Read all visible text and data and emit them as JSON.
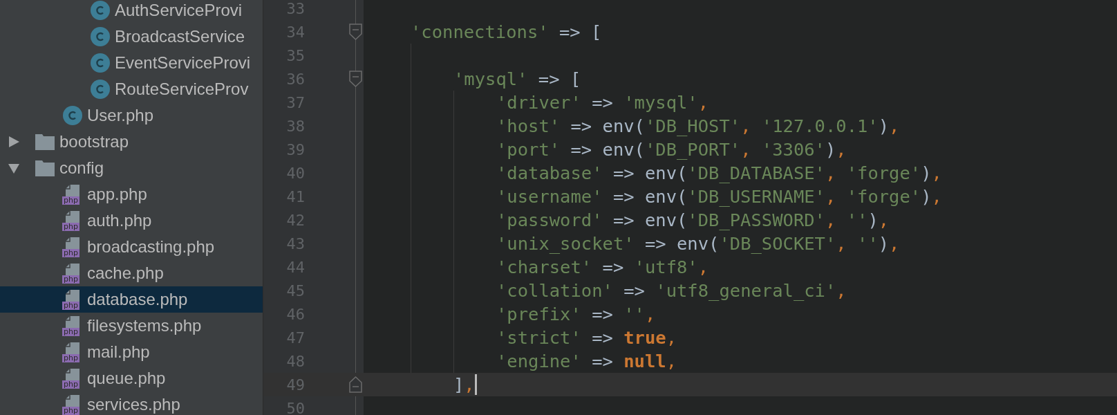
{
  "project_tree": [
    {
      "children": [
        {
          "children": [
            {
              "label": "AuthServiceProvi",
              "kind": "class",
              "selected": false
            },
            {
              "label": "BroadcastService",
              "kind": "class",
              "selected": false
            },
            {
              "label": "EventServiceProvi",
              "kind": "class",
              "selected": false
            },
            {
              "label": "RouteServiceProv",
              "kind": "class",
              "selected": false
            }
          ]
        },
        {
          "label": "User.php",
          "kind": "class",
          "selected": false
        }
      ]
    },
    {
      "label": "bootstrap",
      "kind": "folder",
      "expanded": false,
      "selected": false
    },
    {
      "label": "config",
      "kind": "folder",
      "expanded": true,
      "selected": false,
      "children": [
        {
          "label": "app.php",
          "kind": "php",
          "badge": "php",
          "selected": false
        },
        {
          "label": "auth.php",
          "kind": "php",
          "badge": "php",
          "selected": false
        },
        {
          "label": "broadcasting.php",
          "kind": "php",
          "badge": "php",
          "selected": false
        },
        {
          "label": "cache.php",
          "kind": "php",
          "badge": "php",
          "selected": false
        },
        {
          "label": "database.php",
          "kind": "php",
          "badge": "php",
          "selected": true
        },
        {
          "label": "filesystems.php",
          "kind": "php",
          "badge": "php",
          "selected": false
        },
        {
          "label": "mail.php",
          "kind": "php",
          "badge": "php",
          "selected": false
        },
        {
          "label": "queue.php",
          "kind": "php",
          "badge": "php",
          "selected": false
        },
        {
          "label": "services.php",
          "kind": "php",
          "badge": "php",
          "selected": false
        }
      ]
    }
  ],
  "editor": {
    "lines": [
      {
        "number": "33",
        "current": false
      },
      {
        "number": "34",
        "current": false,
        "fold_start": true,
        "tokens": [
          {
            "kind": "str",
            "text": "'connections'"
          },
          {
            "kind": "plain",
            "text": " => ["
          }
        ],
        "children": [
          {
            "number": "35",
            "current": false
          },
          {
            "number": "36",
            "current": false,
            "fold_start": true,
            "tokens": [
              {
                "kind": "str",
                "text": "'mysql'"
              },
              {
                "kind": "plain",
                "text": " => ["
              }
            ],
            "children": [
              {
                "number": "37",
                "current": false,
                "tokens": [
                  {
                    "kind": "str",
                    "text": "'driver'"
                  },
                  {
                    "kind": "plain",
                    "text": " => "
                  },
                  {
                    "kind": "str",
                    "text": "'mysql'"
                  },
                  {
                    "kind": "comma",
                    "text": ","
                  }
                ]
              },
              {
                "number": "38",
                "current": false,
                "tokens": [
                  {
                    "kind": "str",
                    "text": "'host'"
                  },
                  {
                    "kind": "plain",
                    "text": " => env("
                  },
                  {
                    "kind": "str",
                    "text": "'DB_HOST'"
                  },
                  {
                    "kind": "comma",
                    "text": ", "
                  },
                  {
                    "kind": "str",
                    "text": "'127.0.0.1'"
                  },
                  {
                    "kind": "plain",
                    "text": ")"
                  },
                  {
                    "kind": "comma",
                    "text": ","
                  }
                ]
              },
              {
                "number": "39",
                "current": false,
                "tokens": [
                  {
                    "kind": "str",
                    "text": "'port'"
                  },
                  {
                    "kind": "plain",
                    "text": " => env("
                  },
                  {
                    "kind": "str",
                    "text": "'DB_PORT'"
                  },
                  {
                    "kind": "comma",
                    "text": ", "
                  },
                  {
                    "kind": "str",
                    "text": "'3306'"
                  },
                  {
                    "kind": "plain",
                    "text": ")"
                  },
                  {
                    "kind": "comma",
                    "text": ","
                  }
                ]
              },
              {
                "number": "40",
                "current": false,
                "tokens": [
                  {
                    "kind": "str",
                    "text": "'database'"
                  },
                  {
                    "kind": "plain",
                    "text": " => env("
                  },
                  {
                    "kind": "str",
                    "text": "'DB_DATABASE'"
                  },
                  {
                    "kind": "comma",
                    "text": ", "
                  },
                  {
                    "kind": "str",
                    "text": "'forge'"
                  },
                  {
                    "kind": "plain",
                    "text": ")"
                  },
                  {
                    "kind": "comma",
                    "text": ","
                  }
                ]
              },
              {
                "number": "41",
                "current": false,
                "tokens": [
                  {
                    "kind": "str",
                    "text": "'username'"
                  },
                  {
                    "kind": "plain",
                    "text": " => env("
                  },
                  {
                    "kind": "str",
                    "text": "'DB_USERNAME'"
                  },
                  {
                    "kind": "comma",
                    "text": ", "
                  },
                  {
                    "kind": "str",
                    "text": "'forge'"
                  },
                  {
                    "kind": "plain",
                    "text": ")"
                  },
                  {
                    "kind": "comma",
                    "text": ","
                  }
                ]
              },
              {
                "number": "42",
                "current": false,
                "tokens": [
                  {
                    "kind": "str",
                    "text": "'password'"
                  },
                  {
                    "kind": "plain",
                    "text": " => env("
                  },
                  {
                    "kind": "str",
                    "text": "'DB_PASSWORD'"
                  },
                  {
                    "kind": "comma",
                    "text": ", "
                  },
                  {
                    "kind": "str",
                    "text": "''"
                  },
                  {
                    "kind": "plain",
                    "text": ")"
                  },
                  {
                    "kind": "comma",
                    "text": ","
                  }
                ]
              },
              {
                "number": "43",
                "current": false,
                "tokens": [
                  {
                    "kind": "str",
                    "text": "'unix_socket'"
                  },
                  {
                    "kind": "plain",
                    "text": " => env("
                  },
                  {
                    "kind": "str",
                    "text": "'DB_SOCKET'"
                  },
                  {
                    "kind": "comma",
                    "text": ", "
                  },
                  {
                    "kind": "str",
                    "text": "''"
                  },
                  {
                    "kind": "plain",
                    "text": ")"
                  },
                  {
                    "kind": "comma",
                    "text": ","
                  }
                ]
              },
              {
                "number": "44",
                "current": false,
                "tokens": [
                  {
                    "kind": "str",
                    "text": "'charset'"
                  },
                  {
                    "kind": "plain",
                    "text": " => "
                  },
                  {
                    "kind": "str",
                    "text": "'utf8'"
                  },
                  {
                    "kind": "comma",
                    "text": ","
                  }
                ]
              },
              {
                "number": "45",
                "current": false,
                "tokens": [
                  {
                    "kind": "str",
                    "text": "'collation'"
                  },
                  {
                    "kind": "plain",
                    "text": " => "
                  },
                  {
                    "kind": "str",
                    "text": "'utf8_general_ci'"
                  },
                  {
                    "kind": "comma",
                    "text": ","
                  }
                ]
              },
              {
                "number": "46",
                "current": false,
                "tokens": [
                  {
                    "kind": "str",
                    "text": "'prefix'"
                  },
                  {
                    "kind": "plain",
                    "text": " => "
                  },
                  {
                    "kind": "str",
                    "text": "''"
                  },
                  {
                    "kind": "comma",
                    "text": ","
                  }
                ]
              },
              {
                "number": "47",
                "current": false,
                "tokens": [
                  {
                    "kind": "str",
                    "text": "'strict'"
                  },
                  {
                    "kind": "plain",
                    "text": " => "
                  },
                  {
                    "kind": "kw",
                    "text": "true"
                  },
                  {
                    "kind": "comma",
                    "text": ","
                  }
                ]
              },
              {
                "number": "48",
                "current": false,
                "tokens": [
                  {
                    "kind": "str",
                    "text": "'engine'"
                  },
                  {
                    "kind": "plain",
                    "text": " => "
                  },
                  {
                    "kind": "kw",
                    "text": "null"
                  },
                  {
                    "kind": "comma",
                    "text": ","
                  }
                ]
              }
            ]
          },
          {
            "number": "49",
            "current": true,
            "caret": true,
            "fold_end": true,
            "tokens": [
              {
                "kind": "plain",
                "text": "]"
              },
              {
                "kind": "comma",
                "text": ","
              }
            ]
          }
        ]
      },
      {
        "number": "50",
        "current": false
      }
    ]
  }
}
